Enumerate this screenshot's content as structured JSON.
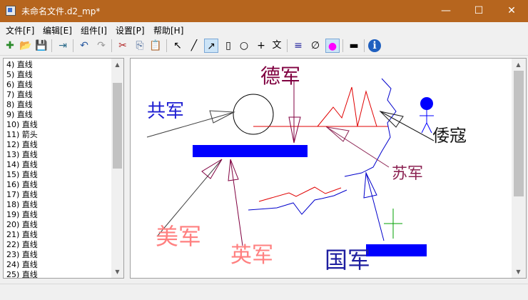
{
  "window": {
    "title": "未命名文件.d2_mp*",
    "minimize_glyph": "—",
    "maximize_glyph": "☐",
    "close_glyph": "✕"
  },
  "menu": [
    {
      "label": "文件[F]"
    },
    {
      "label": "编辑[E]"
    },
    {
      "label": "组件[I]"
    },
    {
      "label": "设置[P]"
    },
    {
      "label": "帮助[H]"
    }
  ],
  "toolbar": [
    {
      "name": "new-file-icon",
      "glyph": "✚"
    },
    {
      "name": "open-file-icon",
      "glyph": "📂"
    },
    {
      "name": "save-file-icon",
      "glyph": "💾"
    },
    {
      "name": "export-icon",
      "glyph": "⇥"
    },
    {
      "name": "undo-icon",
      "glyph": "↶"
    },
    {
      "name": "redo-icon",
      "glyph": "↷"
    },
    {
      "name": "cut-icon",
      "glyph": "✂"
    },
    {
      "name": "copy-icon",
      "glyph": "⎘"
    },
    {
      "name": "paste-icon",
      "glyph": "📋"
    },
    {
      "name": "select-tool-icon",
      "glyph": "↖"
    },
    {
      "name": "line-tool-icon",
      "glyph": "╱"
    },
    {
      "name": "arrow-tool-icon",
      "glyph": "↗"
    },
    {
      "name": "rectangle-tool-icon",
      "glyph": "▯"
    },
    {
      "name": "circle-tool-icon",
      "glyph": "○"
    },
    {
      "name": "cross-tool-icon",
      "glyph": "+"
    },
    {
      "name": "text-tool-icon",
      "glyph": "文"
    },
    {
      "name": "line-color-icon",
      "glyph": "≡"
    },
    {
      "name": "no-fill-icon",
      "glyph": "∅"
    },
    {
      "name": "fill-color-icon",
      "glyph": "●"
    },
    {
      "name": "line-style-icon",
      "glyph": "▬"
    },
    {
      "name": "info-icon",
      "glyph": "ℹ"
    }
  ],
  "list": {
    "items": [
      "4) 直线",
      "5) 直线",
      "6) 直线",
      "7) 直线",
      "8) 直线",
      "9) 直线",
      "10) 直线",
      "11) 箭头",
      "12) 直线",
      "13) 直线",
      "14) 直线",
      "15) 直线",
      "16) 直线",
      "17) 直线",
      "18) 直线",
      "19) 直线",
      "20) 直线",
      "21) 直线",
      "22) 直线",
      "23) 直线",
      "24) 直线",
      "25) 直线"
    ],
    "scroll_up_glyph": "▲",
    "scroll_down_glyph": "▼"
  },
  "canvas": {
    "labels": {
      "german": "德军",
      "communist": "共军",
      "japanese": "倭寇",
      "soviet": "苏军",
      "american": "美军",
      "british": "英军",
      "nationalist": "国军"
    },
    "colors": {
      "german": "#800040",
      "communist": "#1e1ed2",
      "japanese": "#1a1a1a",
      "soviet": "#8b2252",
      "american": "#ff8080",
      "british": "#ff8080",
      "nationalist": "#1e1ea0",
      "blue_bar": "#0000ff",
      "red_line": "#e00000",
      "blue_line": "#0000cc",
      "green_cross": "#00a000",
      "arrow_dark": "#404040"
    },
    "scroll_up_glyph": "▲",
    "scroll_down_glyph": "▼"
  }
}
